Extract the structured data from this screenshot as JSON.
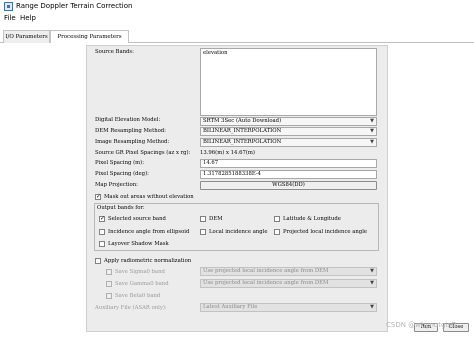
{
  "window": {
    "title": "Range Doppler Terrain Correction"
  },
  "menu": {
    "file": "File",
    "help": "Help"
  },
  "tabs": {
    "io": "I/O Parameters",
    "processing": "Processing Parameters"
  },
  "form": {
    "source_bands_label": "Source Bands:",
    "source_bands_items": [
      "elevation"
    ],
    "dem_label": "Digital Elevation Model:",
    "dem_value": "SRTM 3Sec (Auto Download)",
    "dem_resampling_label": "DEM Resampling Method:",
    "dem_resampling_value": "BILINEAR_INTERPOLATION",
    "image_resampling_label": "Image Resampling Method:",
    "image_resampling_value": "BILINEAR_INTERPOLATION",
    "source_gr_label": "Source GR Pixel Spacings (az x rg):",
    "source_gr_value": "13.96(m) x 14.67(m)",
    "pixel_spacing_m_label": "Pixel Spacing (m):",
    "pixel_spacing_m_value": "14.67",
    "pixel_spacing_deg_label": "Pixel Spacing (deg):",
    "pixel_spacing_deg_value": "1.3178285188338E-4",
    "map_projection_label": "Map Projection:",
    "map_projection_value": "WGS84(DD)",
    "mask_out_label": "Mask out areas without elevation",
    "output_bands_label": "Output bands for:",
    "selected_source_band": "Selected source band",
    "dem": "DEM",
    "lat_lon": "Latitude & Longitude",
    "incidence_ellipsoid": "Incidence angle from ellipsoid",
    "local_incidence": "Local incidence angle",
    "projected_local_incidence": "Projected local incidence angle",
    "layover_shadow": "Layover Shadow Mask",
    "apply_radiometric": "Apply radiometric normalization",
    "save_sigma0": "Save Sigma0 band",
    "save_sigma0_value": "Use projected local incidence angle from DEM",
    "save_gamma0": "Save Gamma0 band",
    "save_gamma0_value": "Use projected local incidence angle from DEM",
    "save_beta0": "Save Beta0 band",
    "auxiliary_label": "Auxiliary File (ASAR only):",
    "auxiliary_value": "Latest Auxiliary File"
  },
  "buttons": {
    "run": "Run",
    "close": "Close"
  },
  "watermark": "CSDN @whynotgisQ",
  "checks": {
    "mask_out": true,
    "selected_source_band": true,
    "dem": false,
    "lat_lon": false,
    "incidence_ellipsoid": false,
    "local_incidence": false,
    "projected_local_incidence": false,
    "layover_shadow": false,
    "apply_radiometric": false,
    "save_sigma0": false,
    "save_gamma0": false,
    "save_beta0": false
  },
  "icons": {
    "app": "app-icon",
    "dropdown": "chevron-down-icon"
  }
}
